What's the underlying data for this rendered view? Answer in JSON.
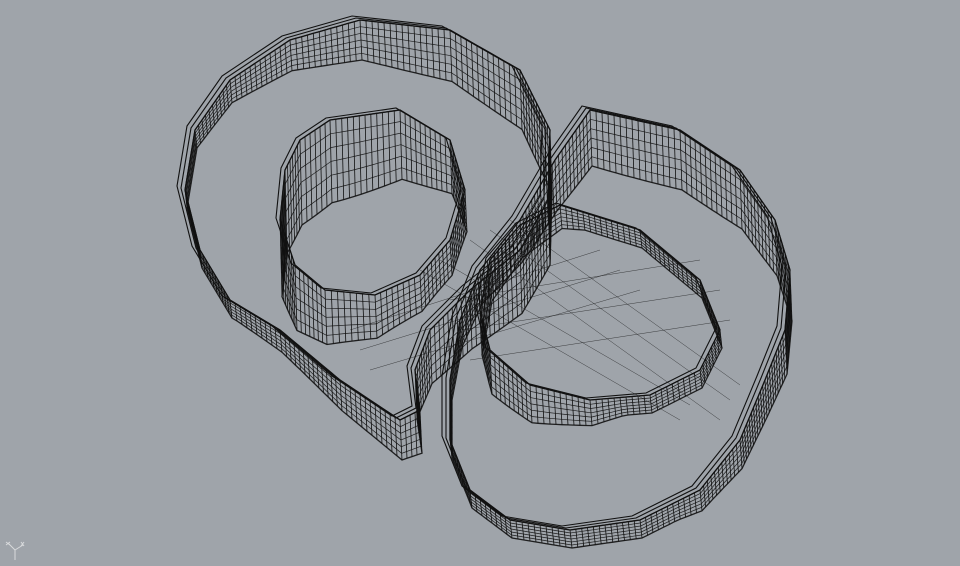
{
  "viewport": {
    "mode": "wireframe",
    "projection": "perspective",
    "background_color": "#9fa4aa",
    "wire_color": "#111111"
  },
  "model": {
    "shape": "figure-eight lattice wall",
    "lobes": 2,
    "inner_openings": 2
  },
  "axis_widget": {
    "icon": "world-axes-icon"
  }
}
